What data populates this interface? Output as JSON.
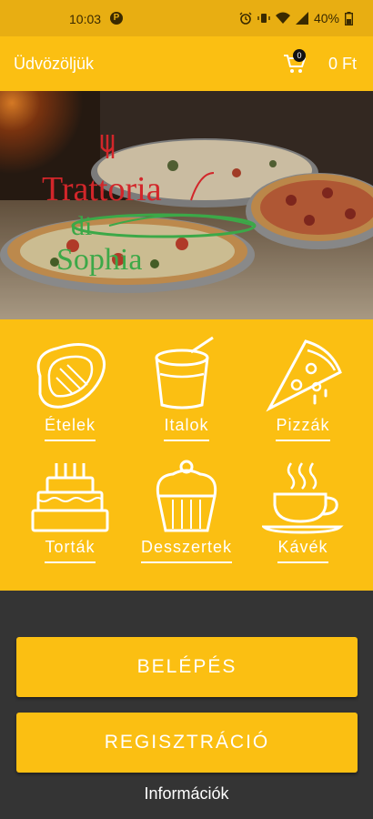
{
  "status_bar": {
    "time": "10:03",
    "app_icon_letter": "P",
    "battery": "40%"
  },
  "header": {
    "greeting": "Üdvözöljük",
    "cart_count": "0",
    "cart_total": "0 Ft"
  },
  "hero": {
    "logo_line1": "Trattoria",
    "logo_line2": "di",
    "logo_line3": "Sophia"
  },
  "categories": [
    {
      "label": "Ételek",
      "icon": "steak-icon"
    },
    {
      "label": "Italok",
      "icon": "drink-cup-icon"
    },
    {
      "label": "Pizzák",
      "icon": "pizza-slice-icon"
    },
    {
      "label": "Torták",
      "icon": "cake-icon"
    },
    {
      "label": "Desszertek",
      "icon": "cupcake-icon"
    },
    {
      "label": "Kávék",
      "icon": "coffee-cup-icon"
    }
  ],
  "actions": {
    "login": "BELÉPÉS",
    "register": "REGISZTRÁCIÓ",
    "info": "Információk"
  },
  "colors": {
    "accent": "#fbbf12",
    "status_bar": "#e8ae12",
    "background": "#343434",
    "logo_red": "#d2262a",
    "logo_green": "#3ca848"
  }
}
